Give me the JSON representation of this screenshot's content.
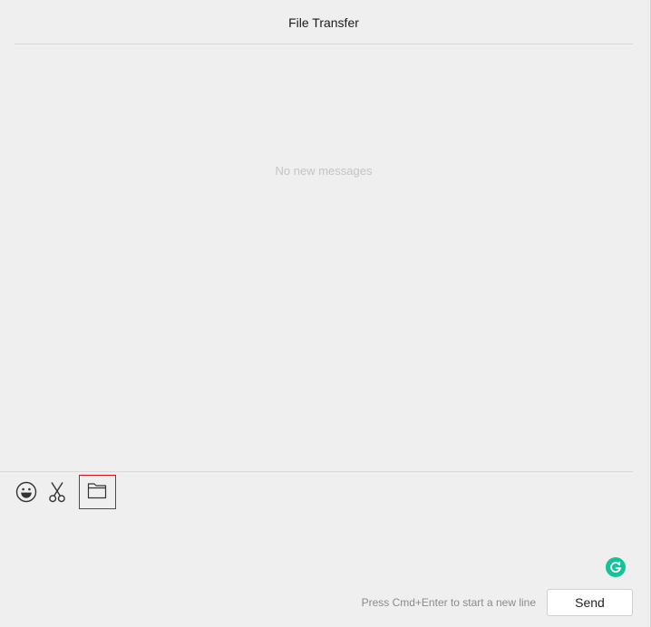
{
  "header": {
    "title": "File Transfer"
  },
  "messages": {
    "empty_text": "No new messages"
  },
  "toolbar": {
    "tools": [
      {
        "name": "emoji",
        "icon": "smiley-face-icon"
      },
      {
        "name": "screenshot",
        "icon": "scissors-icon"
      },
      {
        "name": "send-file",
        "icon": "folder-icon",
        "highlighted": true
      }
    ],
    "highlight_color": "#d0141b"
  },
  "composer": {
    "input_value": "",
    "hint": "Press Cmd+Enter to start a new line",
    "send_label": "Send"
  },
  "extensions": {
    "grammarly_icon": "grammarly-icon",
    "grammarly_color": "#15c39a"
  }
}
